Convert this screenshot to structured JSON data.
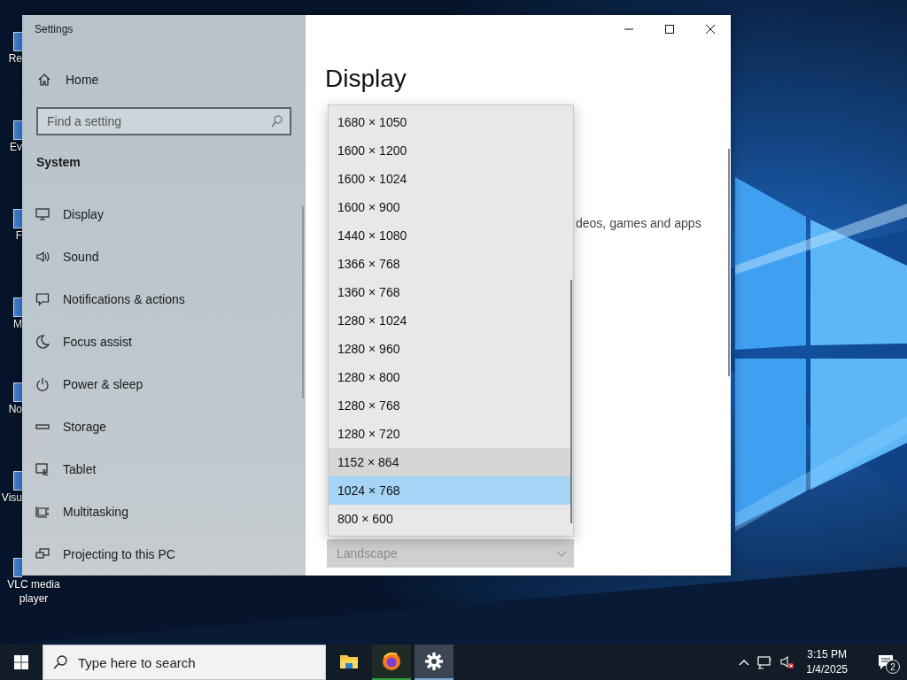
{
  "desktop": {
    "icons": [
      {
        "label": "Re"
      },
      {
        "label": "Ev"
      },
      {
        "label": "F"
      },
      {
        "label": "M"
      },
      {
        "label": "No"
      },
      {
        "label": "Visu"
      },
      {
        "label": "VLC media player"
      }
    ]
  },
  "window": {
    "title": "Settings",
    "sidebar": {
      "home": "Home",
      "search": {
        "placeholder": "Find a setting"
      },
      "section": "System",
      "items": [
        {
          "label": "Display"
        },
        {
          "label": "Sound"
        },
        {
          "label": "Notifications & actions"
        },
        {
          "label": "Focus assist"
        },
        {
          "label": "Power & sleep"
        },
        {
          "label": "Storage"
        },
        {
          "label": "Tablet"
        },
        {
          "label": "Multitasking"
        },
        {
          "label": "Projecting to this PC"
        }
      ]
    },
    "content": {
      "heading": "Display",
      "description_fragment": "deos, games and apps",
      "resolution_options": [
        {
          "label": "1680 × 1050",
          "selected": false,
          "hovered": false
        },
        {
          "label": "1600 × 1200",
          "selected": false,
          "hovered": false
        },
        {
          "label": "1600 × 1024",
          "selected": false,
          "hovered": false
        },
        {
          "label": "1600 × 900",
          "selected": false,
          "hovered": false
        },
        {
          "label": "1440 × 1080",
          "selected": false,
          "hovered": false
        },
        {
          "label": "1366 × 768",
          "selected": false,
          "hovered": false
        },
        {
          "label": "1360 × 768",
          "selected": false,
          "hovered": false
        },
        {
          "label": "1280 × 1024",
          "selected": false,
          "hovered": false
        },
        {
          "label": "1280 × 960",
          "selected": false,
          "hovered": false
        },
        {
          "label": "1280 × 800",
          "selected": false,
          "hovered": false
        },
        {
          "label": "1280 × 768",
          "selected": false,
          "hovered": false
        },
        {
          "label": "1280 × 720",
          "selected": false,
          "hovered": false
        },
        {
          "label": "1152 × 864",
          "selected": false,
          "hovered": true
        },
        {
          "label": "1024 × 768",
          "selected": true,
          "hovered": false
        },
        {
          "label": "800 × 600",
          "selected": false,
          "hovered": false
        }
      ],
      "orientation": {
        "value": "Landscape"
      }
    }
  },
  "taskbar": {
    "search": {
      "placeholder": "Type here to search"
    },
    "apps": [
      {
        "kind": "explorer",
        "active": false,
        "running": false
      },
      {
        "kind": "firefox",
        "active": false,
        "running": true
      },
      {
        "kind": "settings",
        "active": true,
        "running": true
      }
    ],
    "clock": {
      "time": "3:15 PM",
      "date": "1/4/2025"
    },
    "notifications": {
      "count": "2"
    }
  }
}
